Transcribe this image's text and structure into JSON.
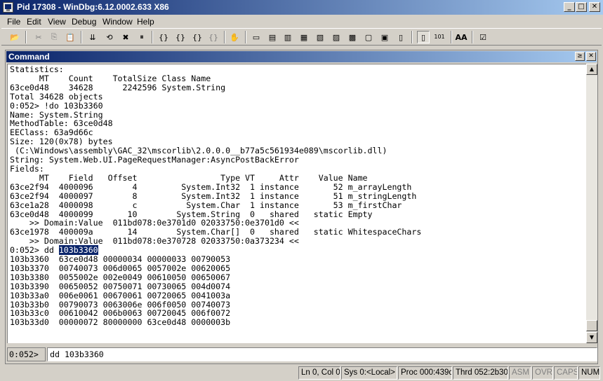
{
  "window": {
    "title": "Pid 17308 - WinDbg:6.12.0002.633 X86",
    "minimize_glyph": "_",
    "maximize_glyph": "□",
    "close_glyph": "✕"
  },
  "menu": [
    "File",
    "Edit",
    "View",
    "Debug",
    "Window",
    "Help"
  ],
  "toolbar": {
    "buttons": [
      {
        "name": "open-icon",
        "glyph": "📂"
      },
      {
        "name": "cut-icon",
        "glyph": "✂"
      },
      {
        "name": "copy-icon",
        "glyph": "⎘"
      },
      {
        "name": "paste-icon",
        "glyph": "📋"
      },
      {
        "name": "go-icon",
        "glyph": "⇊"
      },
      {
        "name": "restart-icon",
        "glyph": "⟲"
      },
      {
        "name": "stop-debugging-icon",
        "glyph": "✖"
      },
      {
        "name": "break-icon",
        "glyph": "⏸"
      },
      {
        "name": "step-into-icon",
        "glyph": "{}"
      },
      {
        "name": "step-over-icon",
        "glyph": "{}"
      },
      {
        "name": "step-out-icon",
        "glyph": "{}"
      },
      {
        "name": "run-to-cursor-icon",
        "glyph": "{}"
      },
      {
        "name": "breakpoint-hand-icon",
        "glyph": "✋"
      },
      {
        "name": "command-window-icon",
        "glyph": "▭"
      },
      {
        "name": "watch-window-icon",
        "glyph": "▤"
      },
      {
        "name": "locals-window-icon",
        "glyph": "▥"
      },
      {
        "name": "registers-window-icon",
        "glyph": "▦"
      },
      {
        "name": "memory-window-icon",
        "glyph": "▧"
      },
      {
        "name": "call-stack-window-icon",
        "glyph": "▨"
      },
      {
        "name": "disassembly-window-icon",
        "glyph": "▩"
      },
      {
        "name": "scratch-pad-icon",
        "glyph": "▢"
      },
      {
        "name": "processes-threads-icon",
        "glyph": "▣"
      },
      {
        "name": "source-mode-icon",
        "glyph": "▯"
      },
      {
        "name": "hex-mode-icon",
        "glyph": "101"
      },
      {
        "name": "font-icon",
        "glyph": "AA"
      },
      {
        "name": "options-icon",
        "glyph": "☑"
      }
    ]
  },
  "command_window": {
    "title": "Command",
    "lines": [
      "Statistics:",
      "      MT    Count    TotalSize Class Name",
      "63ce0d48    34628      2242596 System.String",
      "Total 34628 objects",
      "0:052> !do 103b3360",
      "Name: System.String",
      "MethodTable: 63ce0d48",
      "EEClass: 63a9d66c",
      "Size: 120(0x78) bytes",
      " (C:\\Windows\\assembly\\GAC_32\\mscorlib\\2.0.0.0__b77a5c561934e089\\mscorlib.dll)",
      "String: System.Web.UI.PageRequestManager:AsyncPostBackError",
      "Fields:",
      "      MT    Field   Offset                 Type VT     Attr    Value Name",
      "63ce2f94  4000096        4         System.Int32  1 instance       52 m_arrayLength",
      "63ce2f94  4000097        8         System.Int32  1 instance       51 m_stringLength",
      "63ce1a28  4000098        c          System.Char  1 instance       53 m_firstChar",
      "63ce0d48  4000099       10        System.String  0   shared   static Empty",
      "    >> Domain:Value  011bd078:0e3701d0 02033750:0e3701d0 <<",
      "63ce1978  400009a       14        System.Char[]  0   shared   static WhitespaceChars",
      "    >> Domain:Value  011bd078:0e370728 02033750:0a373234 <<"
    ],
    "dd_prompt": "0:052> dd ",
    "dd_selected": "103b3360",
    "dump_lines": [
      "103b3360  63ce0d48 00000034 00000033 00790053",
      "103b3370  00740073 006d0065 0057002e 00620065",
      "103b3380  0055002e 002e0049 00610050 00650067",
      "103b3390  00650052 00750071 00730065 004d0074",
      "103b33a0  006e0061 00670061 00720065 0041003a",
      "103b33b0  00790073 0063006e 006f0050 00740073",
      "103b33c0  00610042 006b0063 00720045 006f0072",
      "103b33d0  00000072 80000000 63ce0d48 0000003b"
    ],
    "prompt_label": "0:052>",
    "input_value": "dd 103b3360",
    "scroll_up_glyph": "▲",
    "scroll_down_glyph": "▼",
    "caption_cmd_glyph": "≥",
    "caption_close_glyph": "✕"
  },
  "statusbar": {
    "position": "Ln 0, Col 0",
    "system": "Sys 0:<Local>",
    "process": "Proc 000:439c",
    "thread": "Thrd 052:2b30",
    "asm": "ASM",
    "ovr": "OVR",
    "caps": "CAPS",
    "num": "NUM"
  }
}
